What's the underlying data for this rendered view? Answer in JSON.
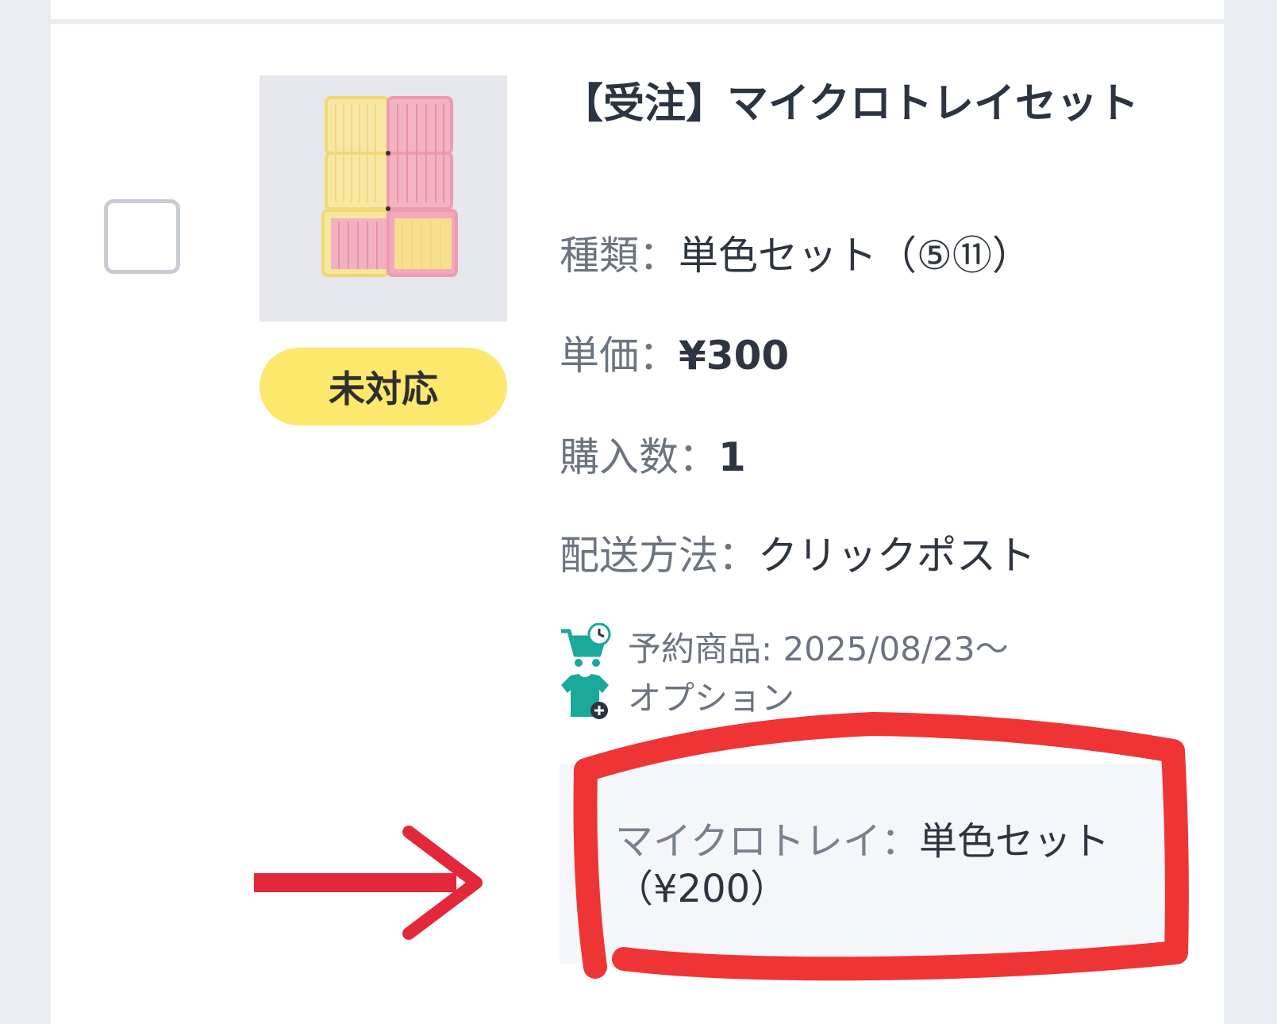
{
  "order_item": {
    "title": "【受注】マイクロトレイセット",
    "status_badge": "未対応",
    "details": {
      "type_label": "種類：",
      "type_value": "単色セット（⑤⑪）",
      "price_label": "単価：",
      "price_value": "¥300",
      "quantity_label": "購入数：",
      "quantity_value": "1",
      "shipping_label": "配送方法：",
      "shipping_value": "クリックポスト"
    },
    "reservation": {
      "icon": "cart-clock-icon",
      "text": "予約商品: 2025/08/23〜"
    },
    "option": {
      "icon": "shirt-plus-icon",
      "text": "オプション"
    },
    "option_detail": {
      "label": "マイクロトレイ：",
      "value": "単色セット（¥200）"
    }
  },
  "colors": {
    "badge": "#fde86e",
    "icon_teal": "#1aa89a",
    "annotation_red": "#ef3435",
    "arrow_red": "#e4283c",
    "page_bg": "#e9ecf1"
  }
}
